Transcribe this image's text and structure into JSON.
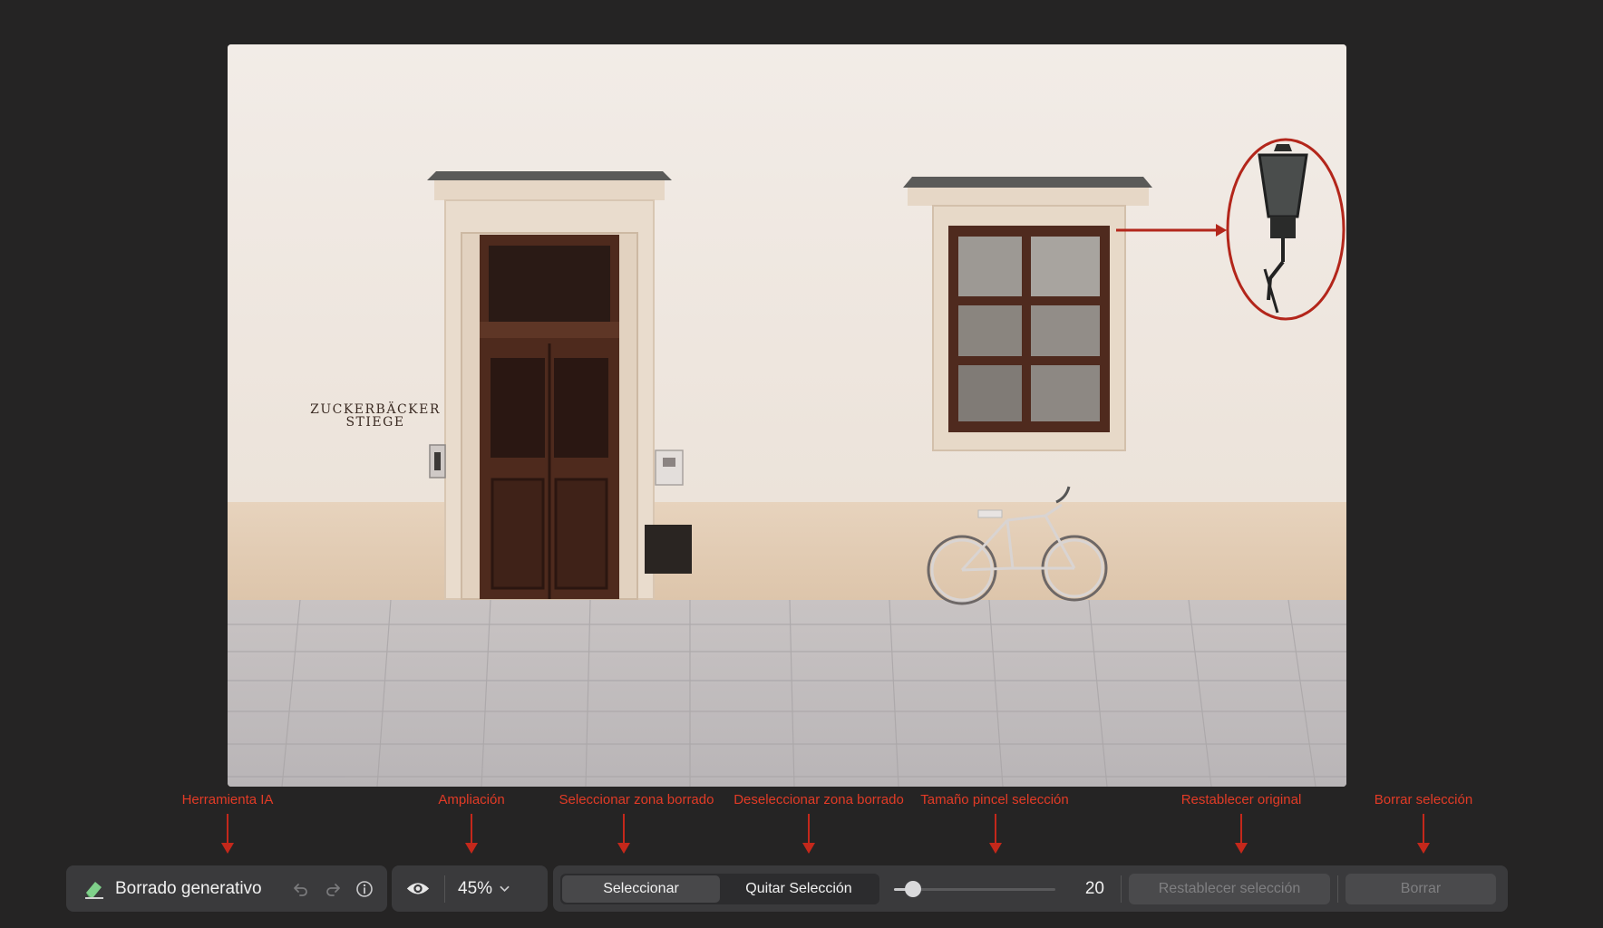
{
  "annotations": [
    {
      "id": "herramienta-ia",
      "label": "Herramienta IA"
    },
    {
      "id": "ampliacion",
      "label": "Ampliación"
    },
    {
      "id": "seleccionar-zona",
      "label": "Seleccionar zona borrado"
    },
    {
      "id": "deseleccionar-zona",
      "label": "Deseleccionar zona borrado"
    },
    {
      "id": "tamano-pincel",
      "label": "Tamaño pincel selección"
    },
    {
      "id": "restablecer-original",
      "label": "Restablecer original"
    },
    {
      "id": "borrar-seleccion",
      "label": "Borrar selección"
    }
  ],
  "photo": {
    "sign_line1": "ZUCKERBÄCKER",
    "sign_line2": "STIEGE"
  },
  "toolbar": {
    "tool_name": "Borrado generativo",
    "zoom_value": "45%",
    "select_label": "Seleccionar",
    "deselect_label": "Quitar Selección",
    "brush_size": "20",
    "brush_fraction": 0.12,
    "reset_label": "Restablecer selección",
    "erase_label": "Borrar"
  },
  "colors": {
    "accent_annotation": "#e23b26",
    "tool_icon": "#7fd08a"
  },
  "icons": {
    "tool": "eraser-icon",
    "undo": "undo-icon",
    "redo": "redo-icon",
    "info": "info-icon",
    "view": "eye-icon",
    "zoom": "chevron-down-icon"
  }
}
